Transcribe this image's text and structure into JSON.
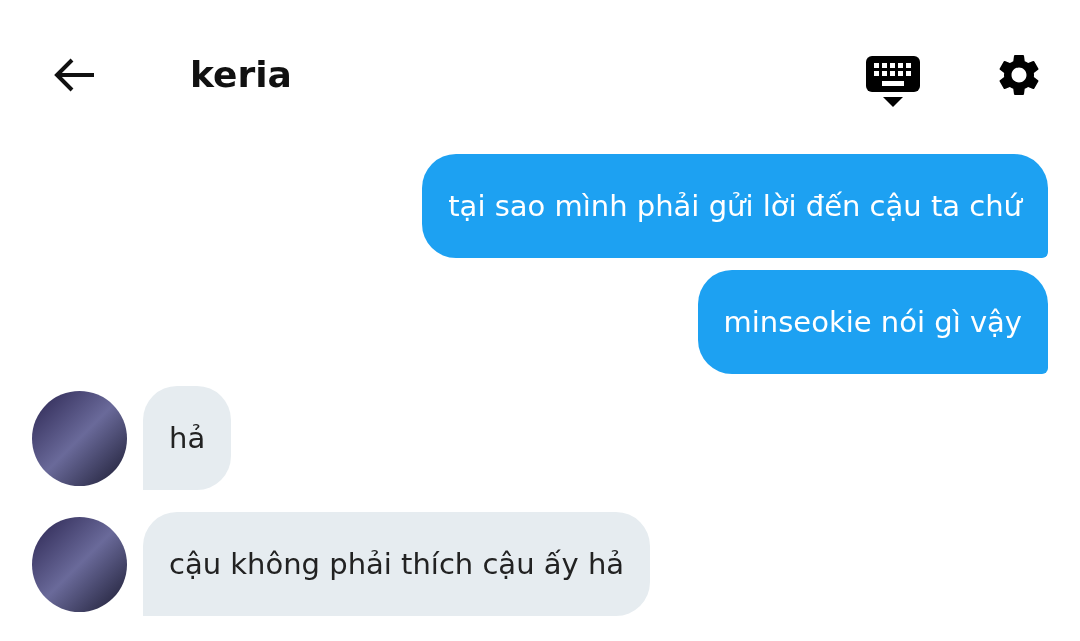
{
  "header": {
    "title": "keria"
  },
  "messages": [
    {
      "kind": "sent",
      "text": "tại sao mình phải gửi lời đến cậu ta chứ"
    },
    {
      "kind": "sent",
      "text": "minseokie nói gì vậy"
    },
    {
      "kind": "received",
      "text": "hả"
    },
    {
      "kind": "received",
      "text": "cậu không phải thích cậu ấy hả"
    }
  ]
}
